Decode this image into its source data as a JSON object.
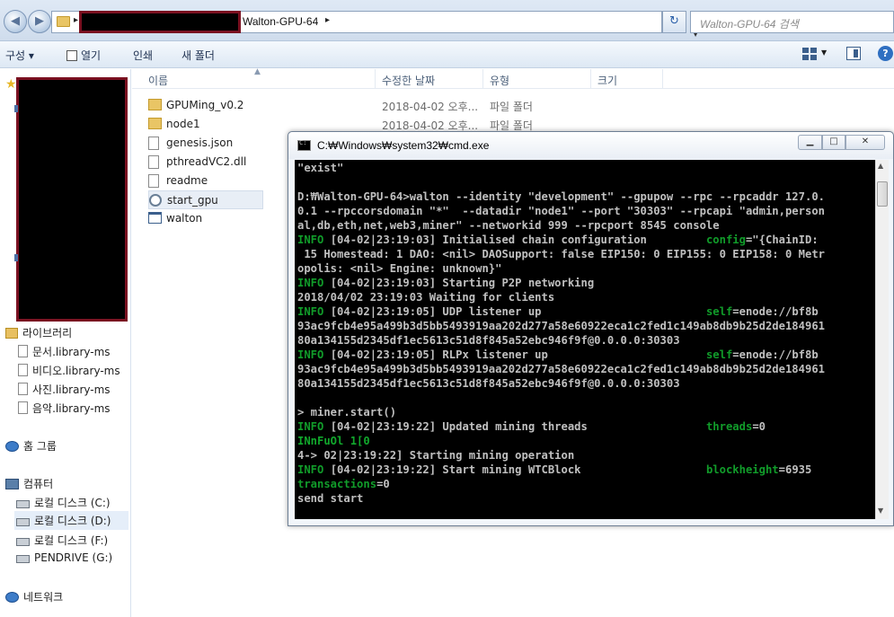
{
  "explorer": {
    "breadcrumb": {
      "current": "Walton-GPU-64"
    },
    "search_placeholder": "Walton-GPU-64 검색",
    "toolbar": {
      "organize": "구성 ▾",
      "open": "열기",
      "print": "인쇄",
      "new_folder": "새 폴더"
    },
    "nav": {
      "libraries": "라이브러리",
      "library_items": [
        "문서.library-ms",
        "비디오.library-ms",
        "사진.library-ms",
        "음악.library-ms"
      ],
      "homegroup": "홈 그룹",
      "computer": "컴퓨터",
      "drives": [
        "로컬 디스크 (C:)",
        "로컬 디스크 (D:)",
        "로컬 디스크 (F:)",
        "PENDRIVE (G:)"
      ],
      "network": "네트워크"
    },
    "columns": [
      "이름",
      "수정한 날짜",
      "유형",
      "크기"
    ],
    "files": [
      {
        "name": "GPUMing_v0.2",
        "date": "2018-04-02 오후...",
        "type": "파일 폴더",
        "icon": "folder-icon"
      },
      {
        "name": "node1",
        "date": "2018-04-02 오후...",
        "type": "파일 폴더",
        "icon": "folder-icon"
      },
      {
        "name": "genesis.json",
        "date": "",
        "type": "",
        "icon": "file-icon"
      },
      {
        "name": "pthreadVC2.dll",
        "date": "",
        "type": "",
        "icon": "dll-icon"
      },
      {
        "name": "readme",
        "date": "",
        "type": "",
        "icon": "file-icon"
      },
      {
        "name": "start_gpu",
        "date": "",
        "type": "",
        "icon": "batch-gear-icon"
      },
      {
        "name": "walton",
        "date": "",
        "type": "",
        "icon": "exe-icon"
      }
    ]
  },
  "cmd": {
    "title": "C:₩Windows₩system32₩cmd.exe",
    "lines": [
      [
        [
          "\"exist\"",
          "w"
        ]
      ],
      [
        [
          "",
          "w"
        ]
      ],
      [
        [
          "D:₩Walton-GPU-64>walton --identity \"development\" --gpupow --rpc --rpcaddr 127.0.",
          "w"
        ]
      ],
      [
        [
          "0.1 --rpccorsdomain \"*\"  --datadir \"node1\" --port \"30303\" --rpcapi \"admin,person",
          "w"
        ]
      ],
      [
        [
          "al,db,eth,net,web3,miner\" --networkid 999 --rpcport 8545 console",
          "w"
        ]
      ],
      [
        [
          "INFO",
          "g"
        ],
        [
          " [04-02|23:19:03] Initialised chain configuration         ",
          "w"
        ],
        [
          "config",
          "g"
        ],
        [
          "=\"{ChainID:",
          "w"
        ]
      ],
      [
        [
          " 15 Homestead: 1 DAO: <nil> DAOSupport: false EIP150: 0 EIP155: 0 EIP158: 0 Metr",
          "w"
        ]
      ],
      [
        [
          "opolis: <nil> Engine: unknown}\"",
          "w"
        ]
      ],
      [
        [
          "INFO",
          "g"
        ],
        [
          " [04-02|23:19:03] Starting P2P networking",
          "w"
        ]
      ],
      [
        [
          "2018/04/02 23:19:03 Waiting for clients",
          "w"
        ]
      ],
      [
        [
          "INFO",
          "g"
        ],
        [
          " [04-02|23:19:05] UDP listener up                         ",
          "w"
        ],
        [
          "self",
          "g"
        ],
        [
          "=enode://bf8b",
          "w"
        ]
      ],
      [
        [
          "93ac9fcb4e95a499b3d5bb5493919aa202d277a58e60922eca1c2fed1c149ab8db9b25d2de184961",
          "w"
        ]
      ],
      [
        [
          "80a134155d2345df1ec5613c51d8f845a52ebc946f9f@0.0.0.0:30303",
          "w"
        ]
      ],
      [
        [
          "INFO",
          "g"
        ],
        [
          " [04-02|23:19:05] RLPx listener up                        ",
          "w"
        ],
        [
          "self",
          "g"
        ],
        [
          "=enode://bf8b",
          "w"
        ]
      ],
      [
        [
          "93ac9fcb4e95a499b3d5bb5493919aa202d277a58e60922eca1c2fed1c149ab8db9b25d2de184961",
          "w"
        ]
      ],
      [
        [
          "80a134155d2345df1ec5613c51d8f845a52ebc946f9f@0.0.0.0:30303",
          "w"
        ]
      ],
      [
        [
          "",
          "w"
        ]
      ],
      [
        [
          "> miner.start()",
          "w"
        ]
      ],
      [
        [
          "INFO",
          "g"
        ],
        [
          " [04-02|23:19:22] Updated mining threads                  ",
          "w"
        ],
        [
          "threads",
          "g"
        ],
        [
          "=0",
          "w"
        ]
      ],
      [
        [
          "INnFuOl 1[0",
          "ly"
        ]
      ],
      [
        [
          "4-> 02|23:19:22] Starting mining operation",
          "w"
        ]
      ],
      [
        [
          "INFO",
          "g"
        ],
        [
          " [04-02|23:19:22] Start mining WTCBlock                   ",
          "w"
        ],
        [
          "blockheight",
          "g"
        ],
        [
          "=6935",
          "w"
        ]
      ],
      [
        [
          "transactions",
          "g"
        ],
        [
          "=0",
          "w"
        ]
      ],
      [
        [
          "send start",
          "w"
        ]
      ]
    ]
  },
  "colors": {
    "console_bg": "#000000",
    "console_text": "#c0c0c0",
    "console_green": "#119c2a",
    "redaction_border": "#7a1020"
  }
}
